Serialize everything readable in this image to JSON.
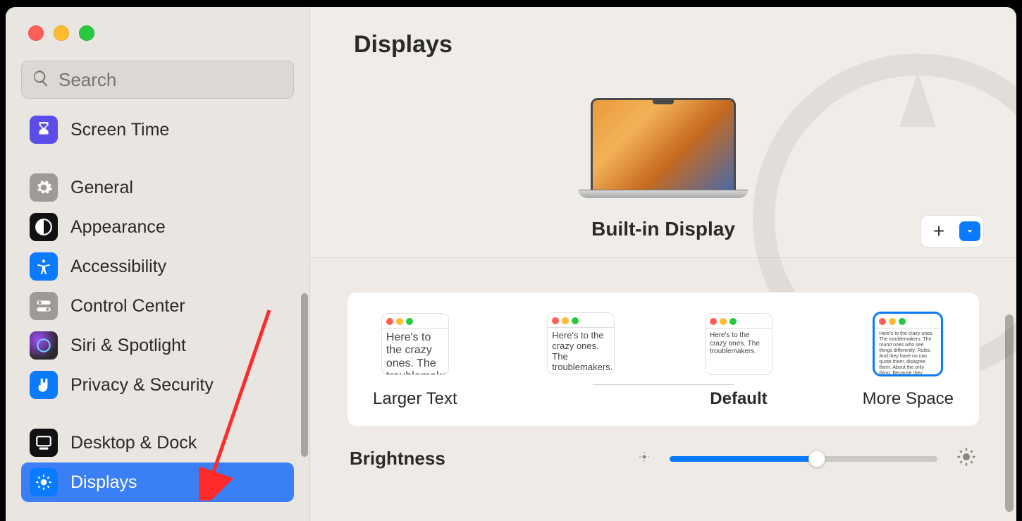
{
  "window": {
    "title": "Displays",
    "search_placeholder": "Search"
  },
  "sidebar": {
    "items": [
      {
        "id": "screen-time",
        "label": "Screen Time",
        "icon": "hourglass"
      },
      {
        "id": "general",
        "label": "General",
        "icon": "gear"
      },
      {
        "id": "appearance",
        "label": "Appearance",
        "icon": "contrast"
      },
      {
        "id": "accessibility",
        "label": "Accessibility",
        "icon": "person"
      },
      {
        "id": "control-center",
        "label": "Control Center",
        "icon": "switches"
      },
      {
        "id": "siri",
        "label": "Siri & Spotlight",
        "icon": "siri"
      },
      {
        "id": "privacy",
        "label": "Privacy & Security",
        "icon": "hand"
      },
      {
        "id": "desktop",
        "label": "Desktop & Dock",
        "icon": "dock"
      },
      {
        "id": "displays",
        "label": "Displays",
        "icon": "sun",
        "selected": true
      }
    ]
  },
  "main": {
    "display_name": "Built-in Display",
    "add_button": "+",
    "resolutions": {
      "larger_label": "Larger Text",
      "default_label": "Default",
      "more_space_label": "More Space",
      "preview_text_short": "Here's to the crazy ones. The troublemakers.",
      "preview_text_long": "Here's to the crazy ones. The troublemakers. The round ones who see things differently. Rules. And they have no can quote them, disagree them. About the only thing. Because they change things.",
      "selected_index": 3
    },
    "brightness_label": "Brightness",
    "brightness_value": 0.55
  }
}
